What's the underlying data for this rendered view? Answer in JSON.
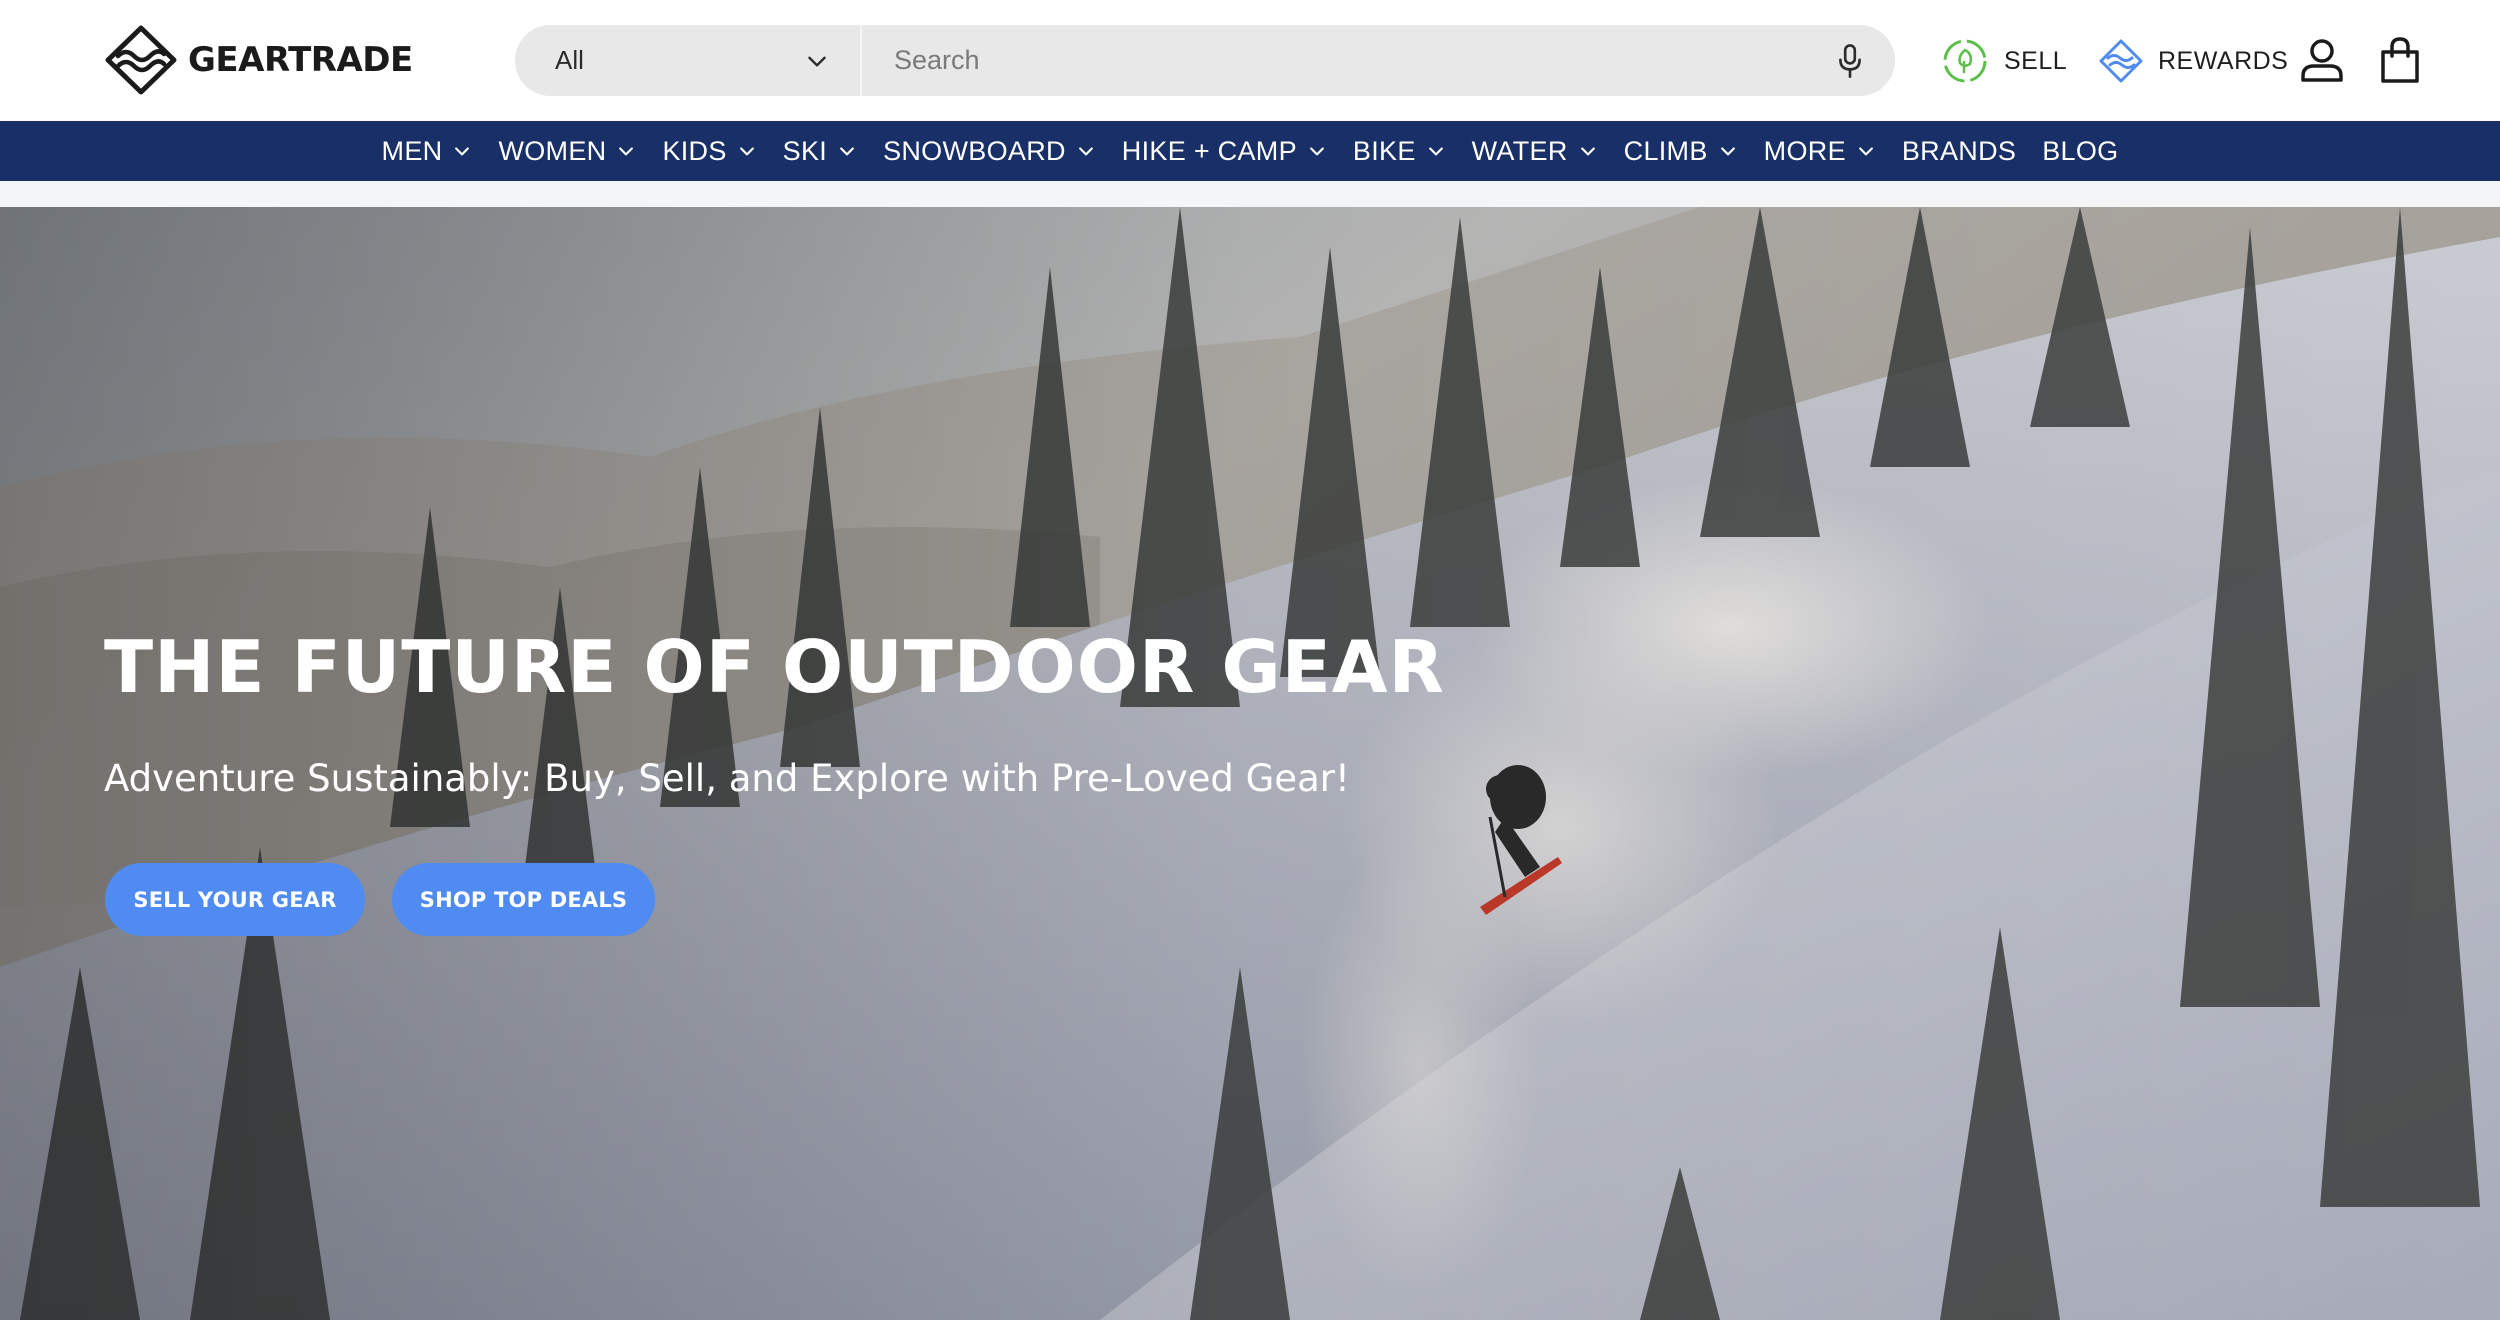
{
  "brand": {
    "name": "GEARTRADE"
  },
  "search": {
    "category_value": "All",
    "placeholder": "Search"
  },
  "header_actions": {
    "sell_label": "SELL",
    "rewards_label": "REWARDS"
  },
  "nav": {
    "items": [
      {
        "label": "MEN",
        "has_dropdown": true
      },
      {
        "label": "WOMEN",
        "has_dropdown": true
      },
      {
        "label": "KIDS",
        "has_dropdown": true
      },
      {
        "label": "SKI",
        "has_dropdown": true
      },
      {
        "label": "SNOWBOARD",
        "has_dropdown": true
      },
      {
        "label": "HIKE + CAMP",
        "has_dropdown": true
      },
      {
        "label": "BIKE",
        "has_dropdown": true
      },
      {
        "label": "WATER",
        "has_dropdown": true
      },
      {
        "label": "CLIMB",
        "has_dropdown": true
      },
      {
        "label": "MORE",
        "has_dropdown": true
      },
      {
        "label": "BRANDS",
        "has_dropdown": false
      },
      {
        "label": "BLOG",
        "has_dropdown": false
      }
    ]
  },
  "hero": {
    "title": "THE FUTURE OF OUTDOOR GEAR",
    "subtitle": "Adventure Sustainably: Buy, Sell, and Explore with Pre-Loved Gear!",
    "buttons": {
      "sell": "SELL YOUR GEAR",
      "deals": "SHOP TOP DEALS"
    }
  },
  "icons": {
    "logo": "geartrade-logo-icon",
    "category_chevron": "chevron-down-icon",
    "mic": "microphone-icon",
    "sell": "recycle-leaf-icon",
    "rewards": "rewards-diamond-icon",
    "account": "user-icon",
    "cart": "shopping-bag-icon"
  },
  "colors": {
    "nav_bg": "#183067",
    "button_bg": "#4f8bf0",
    "sell_icon": "#5cbf4a",
    "rewards_icon": "#4f8bf0"
  }
}
